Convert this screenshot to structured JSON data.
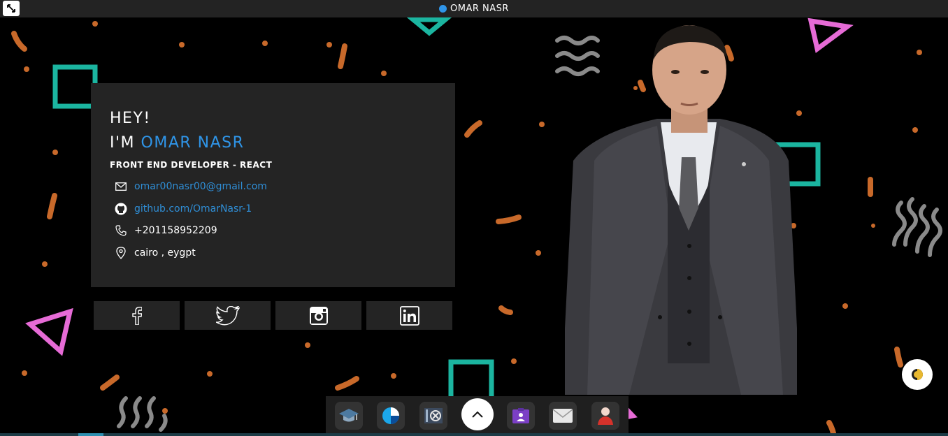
{
  "window": {
    "title": "OMAR NASR"
  },
  "hero": {
    "greeting": "HEY!",
    "intro_prefix": "I'M",
    "name": "OMAR NASR",
    "role": "FRONT END DEVELOPER - REACT"
  },
  "contact": {
    "email": "omar00nasr00@gmail.com",
    "github": "github.com/OmarNasr-1",
    "phone": "+201158952209",
    "location": "cairo , eygpt"
  },
  "social": [
    {
      "icon": "facebook-icon"
    },
    {
      "icon": "twitter-icon"
    },
    {
      "icon": "instagram-icon"
    },
    {
      "icon": "linkedin-icon"
    }
  ],
  "dock": [
    {
      "icon": "graduation-cap-icon"
    },
    {
      "icon": "pie-chart-icon"
    },
    {
      "icon": "settings-gear-icon"
    },
    {
      "icon": "chevron-up-icon"
    },
    {
      "icon": "portfolio-icon"
    },
    {
      "icon": "mail-icon"
    },
    {
      "icon": "contact-person-icon"
    }
  ],
  "colors": {
    "accent": "#2f95e8",
    "link": "#2f8ed6",
    "card": "#242424",
    "topbar": "#232323",
    "teal": "#1bb5a0",
    "pink": "#e66bd6",
    "orange": "#c8692a"
  }
}
